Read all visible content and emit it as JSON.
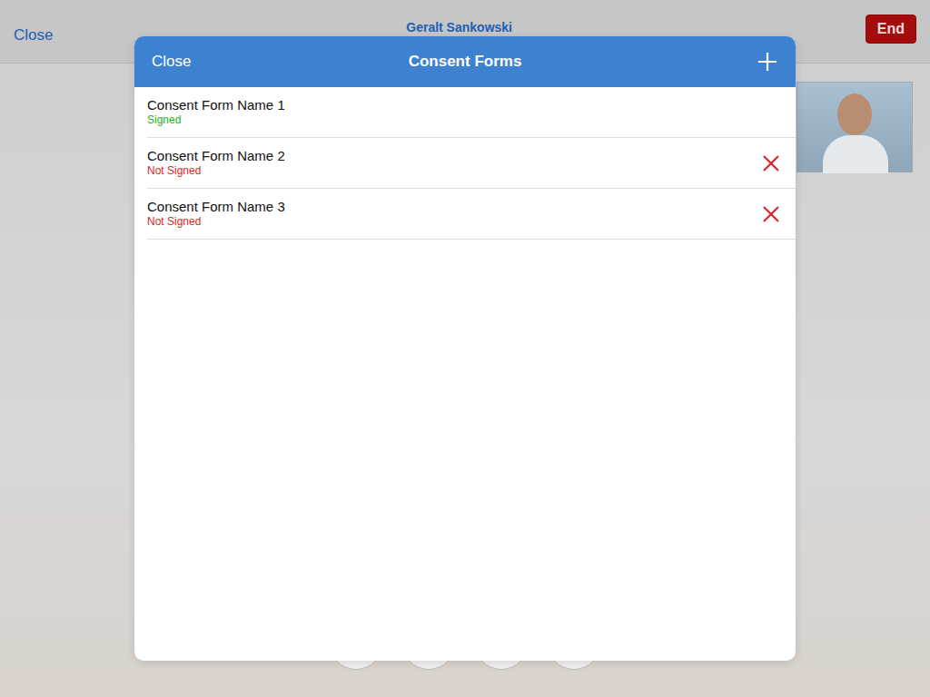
{
  "call": {
    "close": "Close",
    "title": "Geralt Sankowski",
    "end": "End"
  },
  "modal": {
    "close": "Close",
    "title": "Consent Forms"
  },
  "forms": [
    {
      "name": "Consent Form Name 1",
      "status": "Signed",
      "signed": true
    },
    {
      "name": "Consent Form Name 2",
      "status": "Not Signed",
      "signed": false
    },
    {
      "name": "Consent Form Name 3",
      "status": "Not Signed",
      "signed": false
    }
  ]
}
